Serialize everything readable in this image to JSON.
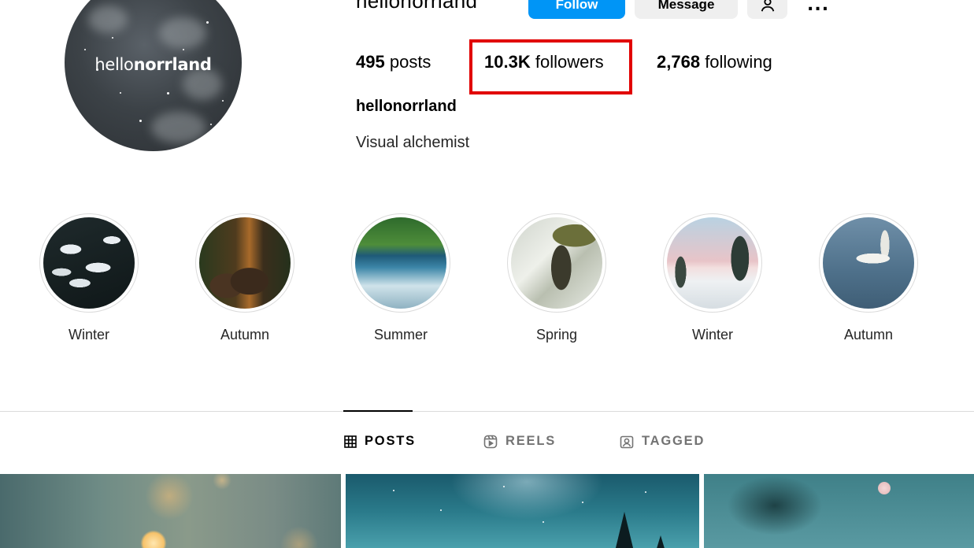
{
  "profile": {
    "username": "hellonorrland",
    "avatar_logo_light": "hello",
    "avatar_logo_bold": "norrland",
    "full_name": "hellonorrland",
    "bio": "Visual alchemist"
  },
  "actions": {
    "follow_label": "Follow",
    "message_label": "Message",
    "more_label": "..."
  },
  "stats": {
    "posts_count": "495",
    "posts_label": "posts",
    "followers_count": "10.3K",
    "followers_label": "followers",
    "following_count": "2,768",
    "following_label": "following"
  },
  "highlights": [
    {
      "label": "Winter"
    },
    {
      "label": "Autumn"
    },
    {
      "label": "Summer"
    },
    {
      "label": "Spring"
    },
    {
      "label": "Winter"
    },
    {
      "label": "Autumn"
    }
  ],
  "tabs": [
    {
      "label": "POSTS",
      "icon": "grid-icon",
      "active": true
    },
    {
      "label": "REELS",
      "icon": "reels-icon",
      "active": false
    },
    {
      "label": "TAGGED",
      "icon": "tagged-icon",
      "active": false
    }
  ],
  "colors": {
    "accent": "#0095f6",
    "highlight_box": "#e10000",
    "secondary_button": "#efefef"
  }
}
